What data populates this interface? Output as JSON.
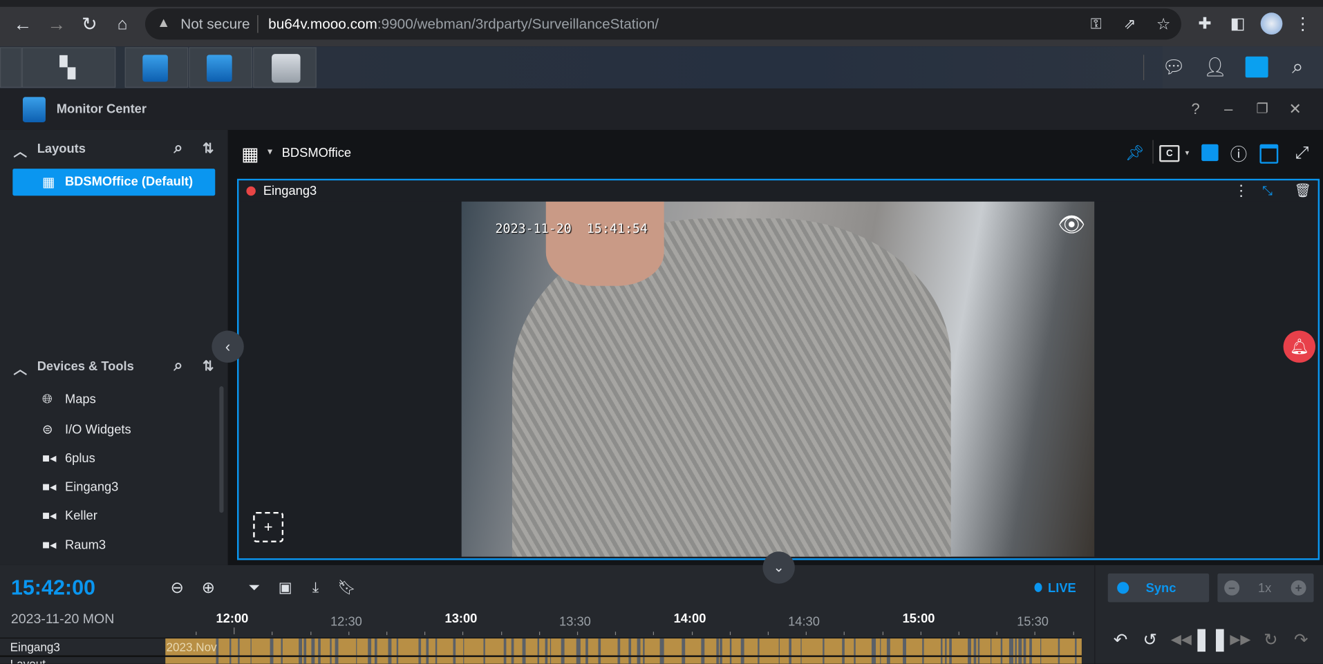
{
  "browser": {
    "security_label": "Not secure",
    "url_host": "bu64v.mooo.com",
    "url_path": ":9900/webman/3rdparty/SurveillanceStation/"
  },
  "window": {
    "title": "Monitor Center",
    "help": "?"
  },
  "sidebar": {
    "layouts_header": "Layouts",
    "layout_items": [
      {
        "label": "BDSMOffice (Default)",
        "selected": true
      }
    ],
    "devices_header": "Devices & Tools",
    "device_items": [
      {
        "label": "Maps",
        "icon": "globe-icon"
      },
      {
        "label": "I/O Widgets",
        "icon": "io-icon"
      },
      {
        "label": "6plus",
        "icon": "camera-icon"
      },
      {
        "label": "Eingang3",
        "icon": "camera-icon"
      },
      {
        "label": "Keller",
        "icon": "camera-icon"
      },
      {
        "label": "Raum3",
        "icon": "camera-icon"
      }
    ]
  },
  "main": {
    "layout_name": "BDSMOffice",
    "camera_name": "Eingang3",
    "video_timestamp": "2023-11-20  15:41:54",
    "accent": "#0a96f0"
  },
  "timeline": {
    "current_time": "15:42:00",
    "date": "2023-11-20 MON",
    "live_label": "LIVE",
    "ticks": [
      "12:00",
      "12:30",
      "13:00",
      "13:30",
      "14:00",
      "14:30",
      "15:00",
      "15:30"
    ],
    "tracks": [
      "Eingang3",
      "Layout"
    ],
    "month_label": "2023.Nov",
    "sync_label": "Sync",
    "speed": "1x"
  }
}
